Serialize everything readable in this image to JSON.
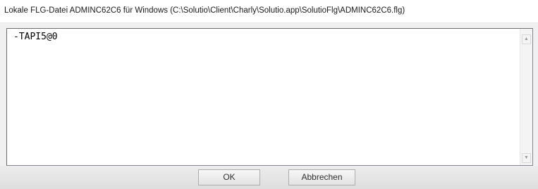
{
  "window": {
    "title": "Lokale FLG-Datei ADMINC62C6 für Windows (C:\\Solutio\\Client\\Charly\\Solutio.app\\SolutioFlg\\ADMINC62C6.flg)"
  },
  "editor": {
    "content": "-TAPI5@0"
  },
  "scrollbar": {
    "up_arrow": "▲",
    "down_arrow": "▼"
  },
  "buttons": {
    "ok_label": "OK",
    "cancel_label": "Abbrechen"
  }
}
